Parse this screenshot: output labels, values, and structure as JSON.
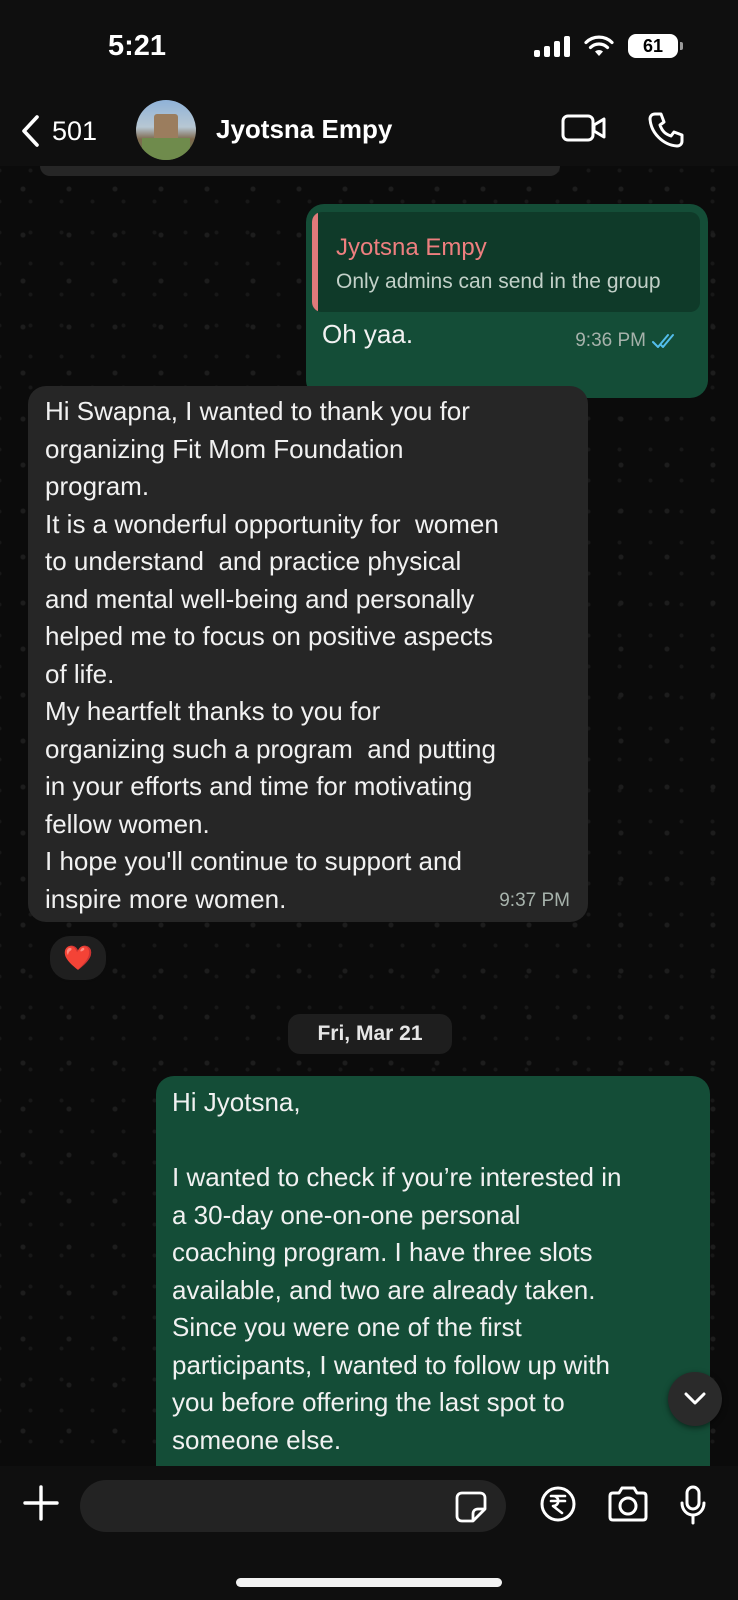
{
  "status_bar": {
    "time": "5:21",
    "battery": "61"
  },
  "header": {
    "back_count": "501",
    "contact_name": "Jyotsna Empy"
  },
  "messages": {
    "reply_quote": {
      "author": "Jyotsna Empy",
      "text": "Only admins can send in the group"
    },
    "reply": {
      "text": "Oh yaa.",
      "time": "9:36 PM"
    },
    "incoming": {
      "text": "Hi Swapna, I wanted to thank you for\norganizing Fit Mom Foundation\nprogram.\nIt is a wonderful opportunity for  women\nto understand  and practice physical\nand mental well-being and personally\nhelped me to focus on positive aspects\nof life.\nMy heartfelt thanks to you for\norganizing such a program  and putting\nin your efforts and time for motivating\nfellow women.\nI hope you'll continue to support and\ninspire more women.",
      "time": "9:37 PM",
      "reaction": "❤️"
    },
    "date_divider": "Fri, Mar 21",
    "outgoing_long": {
      "text": "Hi Jyotsna,\n\nI wanted to check if you’re interested in\na 30-day one-on-one personal\ncoaching program. I have three slots\navailable, and two are already taken.\nSince you were one of the first\nparticipants, I wanted to follow up with\nyou before offering the last spot to\nsomeone else."
    }
  },
  "icons": {
    "back": "chevron-left-icon",
    "video": "video-call-icon",
    "phone": "phone-call-icon",
    "read_receipt": "double-check-icon",
    "scroll_down": "chevron-down-icon",
    "plus": "plus-icon",
    "sticker": "sticker-icon",
    "payment": "rupee-payment-icon",
    "camera": "camera-icon",
    "mic": "microphone-icon"
  },
  "colors": {
    "outgoing_bubble": "#144d37",
    "incoming_bubble": "#262626",
    "quote_author": "#ee7f7f",
    "read_check": "#53bdeb"
  }
}
